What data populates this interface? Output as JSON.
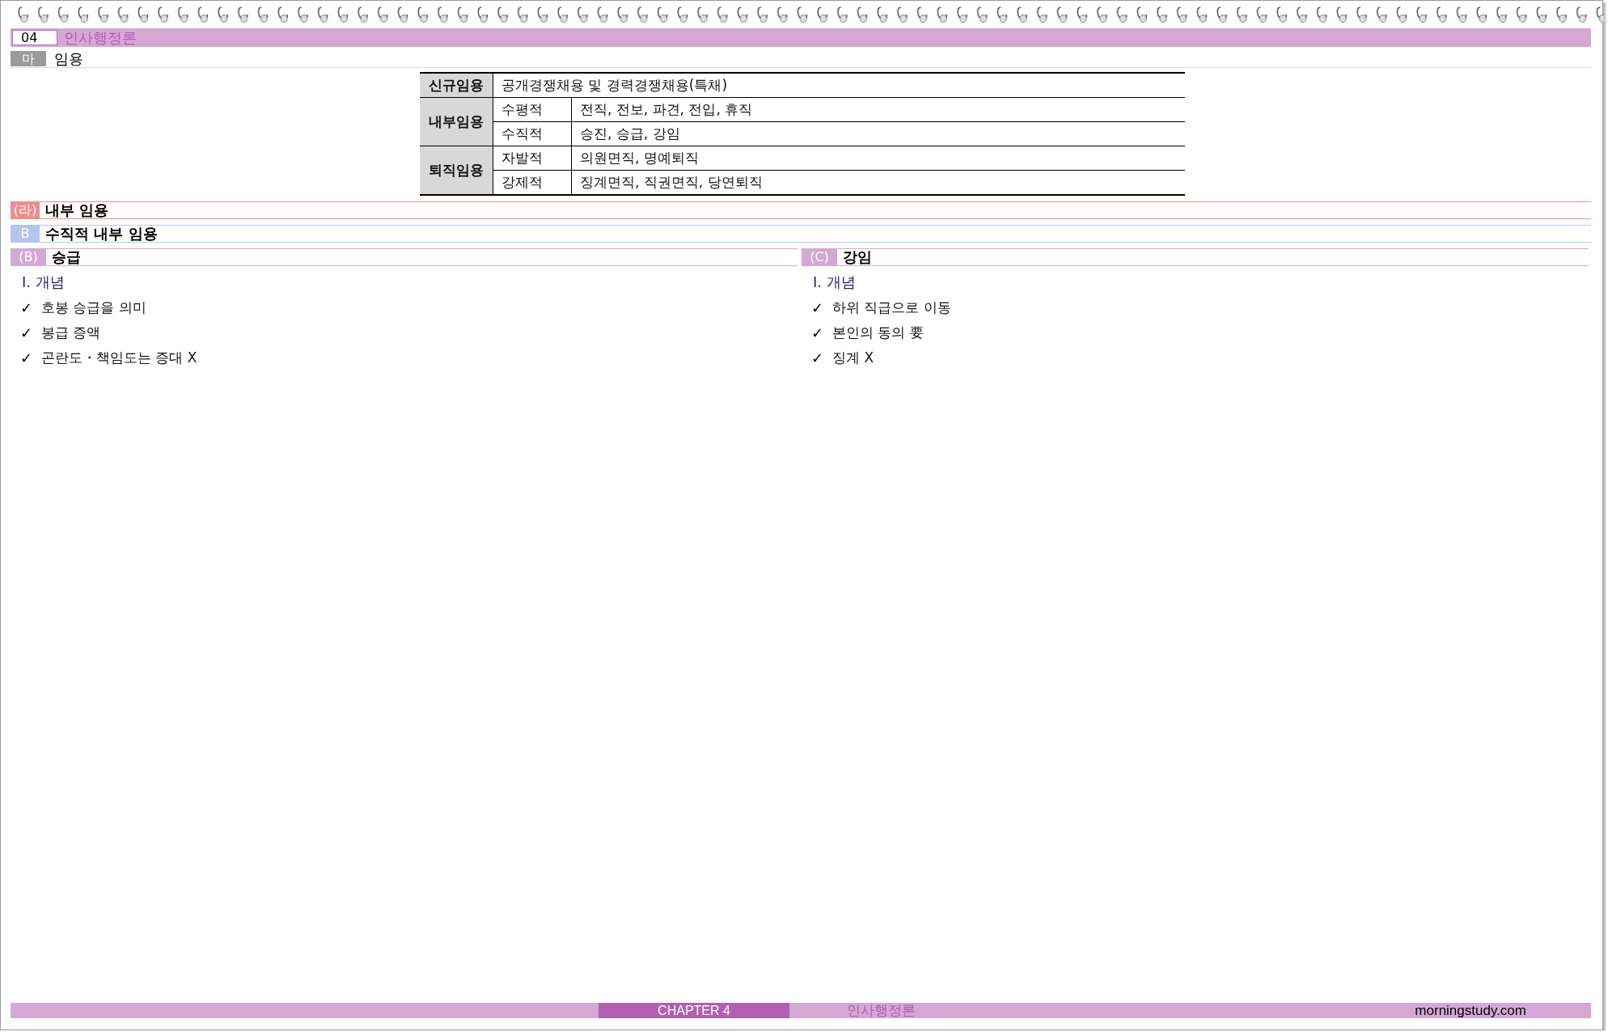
{
  "header": {
    "number": "04",
    "title": "인사행정론"
  },
  "section": {
    "marker": "마",
    "title": "임용"
  },
  "table": {
    "groups": [
      {
        "category": "신규임용",
        "items": [
          {
            "content": "공개경쟁채용 및 경력경쟁채용(특채)"
          }
        ]
      },
      {
        "category": "내부임용",
        "items": [
          {
            "type": "수평적",
            "content": "전직, 전보, 파견, 전입, 휴직"
          },
          {
            "type": "수직적",
            "content": "승진, 승급, 강임"
          }
        ]
      },
      {
        "category": "퇴직임용",
        "items": [
          {
            "type": "자발적",
            "content": "의원면직, 명예퇴직"
          },
          {
            "type": "강제적",
            "content": "징계면직, 직권면직, 당연퇴직"
          }
        ]
      }
    ]
  },
  "headings": [
    {
      "marker": "(라)",
      "title": "내부 임용",
      "color": "#f28c8c"
    },
    {
      "marker": "B",
      "title": "수직적 내부 임용",
      "color": "#b4c6f0"
    }
  ],
  "columns": [
    {
      "marker": "(B)",
      "title": "승급",
      "color": "#d4a8d4",
      "subheading": "Ⅰ. 개념",
      "bullets": [
        {
          "mark": "✓",
          "text": "호봉 승급을 의미"
        },
        {
          "mark": "✓",
          "text": "봉급 증액"
        },
        {
          "mark": "✓",
          "text": "곤란도・책임도는 증대 X"
        }
      ]
    },
    {
      "marker": "(C)",
      "title": "강임",
      "color": "#d4a8d4",
      "subheading": "Ⅰ. 개념",
      "bullets": [
        {
          "mark": "✓",
          "text": "하위 직급으로 이동"
        },
        {
          "mark": "✓",
          "text": "본인의 동의 要"
        },
        {
          "mark": "✓",
          "text": "징계 X"
        }
      ]
    }
  ],
  "footer": {
    "chapter": "CHAPTER 4",
    "subject": "인사행정론",
    "site": "morningstudy.com"
  }
}
